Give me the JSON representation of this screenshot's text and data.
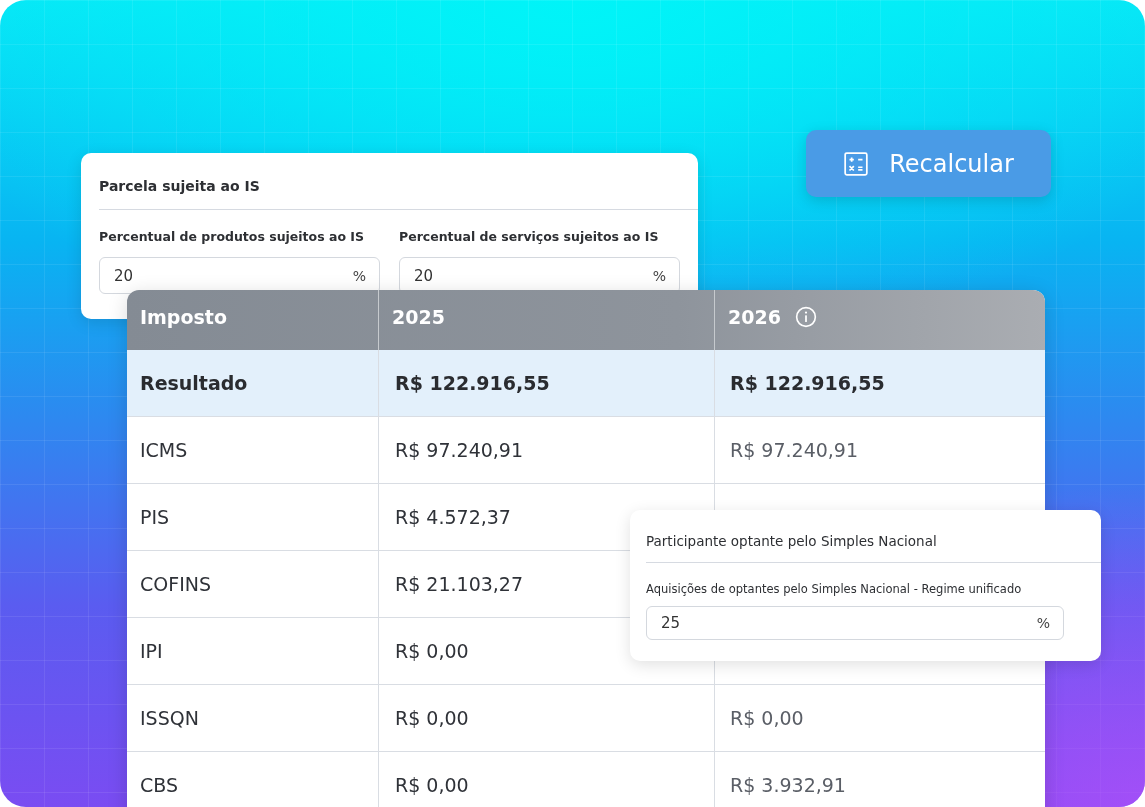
{
  "recalculate_button": {
    "label": "Recalcular"
  },
  "is_share_card": {
    "title": "Parcela sujeita ao IS",
    "fields": [
      {
        "label": "Percentual de produtos sujeitos ao IS",
        "value": "20",
        "unit": "%"
      },
      {
        "label": "Percentual de serviços sujeitos ao IS",
        "value": "20",
        "unit": "%"
      }
    ]
  },
  "tax_table": {
    "columns": [
      {
        "label": "Imposto",
        "info": false
      },
      {
        "label": "2025",
        "info": false
      },
      {
        "label": "2026",
        "info": true
      }
    ],
    "rows": [
      {
        "highlighted": true,
        "cells": [
          "Resultado",
          "R$ 122.916,55",
          "R$ 122.916,55"
        ]
      },
      {
        "highlighted": false,
        "cells": [
          "ICMS",
          "R$ 97.240,91",
          "R$ 97.240,91"
        ]
      },
      {
        "highlighted": false,
        "cells": [
          "PIS",
          "R$ 4.572,37"
        ]
      },
      {
        "highlighted": false,
        "cells": [
          "COFINS",
          "R$ 21.103,27"
        ]
      },
      {
        "highlighted": false,
        "cells": [
          "IPI",
          "R$ 0,00"
        ]
      },
      {
        "highlighted": false,
        "cells": [
          "ISSQN",
          "R$ 0,00",
          "R$ 0,00"
        ]
      },
      {
        "highlighted": false,
        "cells": [
          "CBS",
          "R$ 0,00",
          "R$ 3.932,91"
        ]
      }
    ]
  },
  "simples_card": {
    "title": "Participante optante pelo Simples Nacional",
    "fields": [
      {
        "label": "Aquisições de optantes pelo Simples Nacional - Regime unificado",
        "value": "25",
        "unit": "%"
      }
    ]
  }
}
